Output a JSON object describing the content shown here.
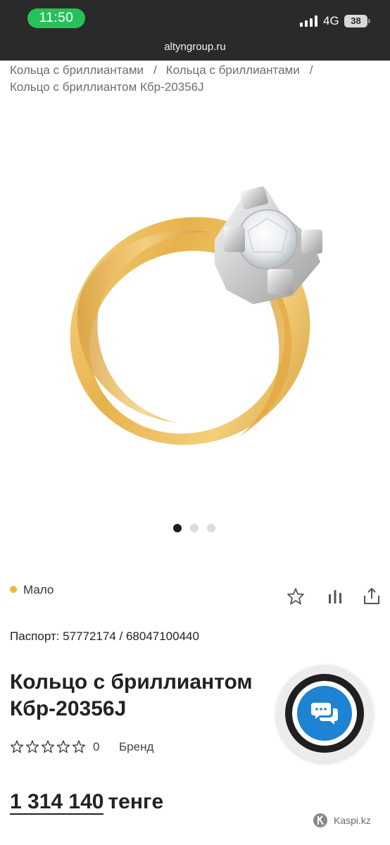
{
  "status_bar": {
    "time": "11:50",
    "network": "4G",
    "battery": "38",
    "domain": "altyngroup.ru"
  },
  "breadcrumb": {
    "items": [
      "Кольца с бриллиантами",
      "Кольца с бриллиантами",
      "Кольцо с бриллиантом Кбр-20356J"
    ],
    "separator": "/"
  },
  "gallery": {
    "image_icon": "gold-diamond-ring-image",
    "current_slide": 1,
    "total_slides": 3
  },
  "availability": {
    "label": "Мало",
    "color": "#f5b639"
  },
  "actions": {
    "favorite_icon": "star-icon",
    "compare_icon": "bar-chart-icon",
    "share_icon": "share-icon"
  },
  "product": {
    "passport": "Паспорт: 57772174 / 68047100440",
    "title": "Кольцо с бриллиантом Кбр-20356J",
    "rating": 0,
    "rating_count": "0",
    "brand_label": "Бренд",
    "price_number": "1 314 140",
    "price_currency": "тенге"
  },
  "chat": {
    "icon": "chat-bubbles-icon",
    "color": "#1e83d2"
  },
  "footer": {
    "kaspi_label": "Kaspi.kz"
  },
  "colors": {
    "status_bar_bg": "#2a2a2a",
    "time_pill": "#27c15a"
  }
}
